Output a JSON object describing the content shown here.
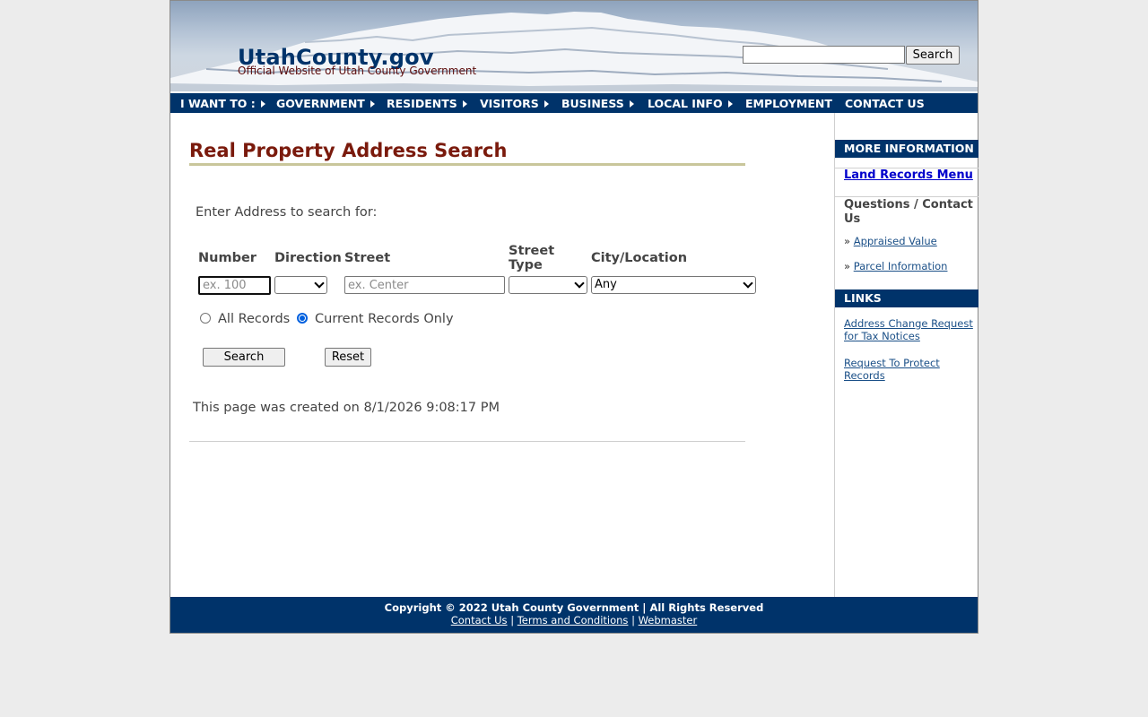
{
  "header": {
    "site_title": "UtahCounty.gov",
    "tagline": "Official Website of Utah County Government",
    "search_button": "Search",
    "search_value": ""
  },
  "nav": {
    "items": [
      {
        "label": "I WANT TO :",
        "has_arrow": true
      },
      {
        "label": "GOVERNMENT",
        "has_arrow": true
      },
      {
        "label": "RESIDENTS",
        "has_arrow": true
      },
      {
        "label": "VISITORS",
        "has_arrow": true
      },
      {
        "label": "BUSINESS",
        "has_arrow": true
      },
      {
        "label": "LOCAL INFO",
        "has_arrow": true
      },
      {
        "label": "EMPLOYMENT",
        "has_arrow": false
      },
      {
        "label": "CONTACT US",
        "has_arrow": false
      }
    ]
  },
  "main": {
    "title": "Real Property Address Search",
    "instruction": "Enter Address to search for:",
    "columns": {
      "number": "Number",
      "direction": "Direction",
      "street": "Street",
      "street_type_1": "Street",
      "street_type_2": "Type",
      "city": "City/Location"
    },
    "number_placeholder": "ex. 100",
    "street_placeholder": "ex. Center",
    "direction_value": "",
    "street_type_value": "",
    "city_value": "Any",
    "radio_all": "All Records",
    "radio_current": "Current Records Only",
    "selected_radio": "current",
    "search_button": "Search",
    "reset_button": "Reset",
    "created_text": "This page was created on 8/1/2026 9:08:17 PM"
  },
  "sidebar": {
    "more_info_heading": "MORE INFORMATION",
    "land_records_link": "Land Records Menu",
    "questions_heading": "Questions / Contact Us",
    "appraised_value_link": "Appraised Value",
    "parcel_info_link": "Parcel Information",
    "bullet": "»",
    "links_heading": "LINKS",
    "address_change_link": "Address Change Request for Tax Notices",
    "protect_records_link": "Request To Protect Records"
  },
  "footer": {
    "copyright": "Copyright © 2022 Utah County Government | All Rights Reserved",
    "contact_link": "Contact Us",
    "terms_link": "Terms and Conditions",
    "webmaster_link": "Webmaster",
    "separator": "|"
  },
  "colors": {
    "navy": "#00336a",
    "title_red": "#7a1a0c",
    "rule_tan": "#c9c69b",
    "page_bg": "#ececec"
  }
}
